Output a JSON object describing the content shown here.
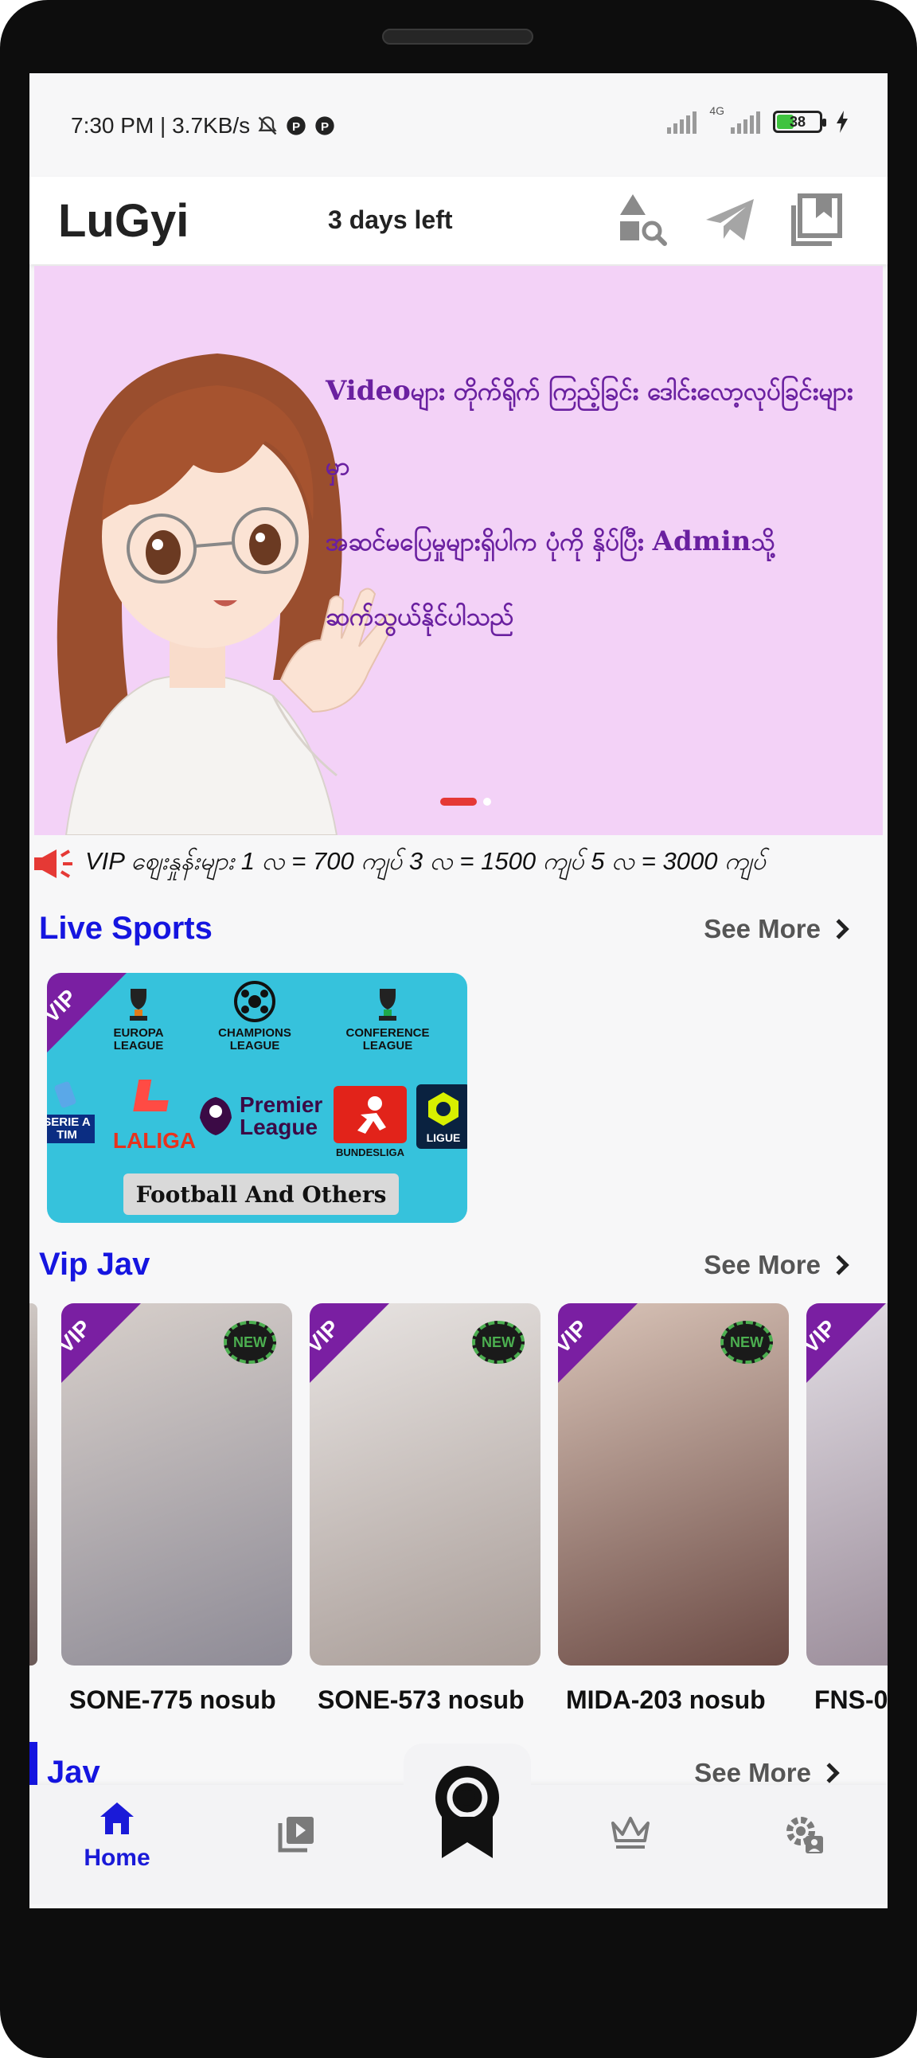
{
  "status_bar": {
    "time_speed": "7:30 PM | 3.7KB/s",
    "network_type": "4G",
    "battery_level": "38"
  },
  "header": {
    "app_name": "LuGyi",
    "days_left": "3 days left",
    "icons": [
      "category-search-icon",
      "telegram-icon",
      "collection-icon"
    ]
  },
  "banner": {
    "line1_bold": "Video",
    "line1_rest": "များ တိုက်ရိုက် ကြည့်ခြင်း ဒေါင်းလော့လုပ်ခြင်းများမှာ",
    "line2_pre": "အဆင်မပြေမှုများရှိပါက ပုံကို နှိပ်ပြီး ",
    "line2_bold": "Admin",
    "line2_post": "သို့",
    "line3": "ဆက်သွယ်နိုင်ပါသည်",
    "slide_count": 2,
    "active_slide": 0
  },
  "announcement": {
    "text": "VIP ဈေးနှုန်းများ 1 လ = 700 ကျပ် 3 လ = 1500 ကျပ် 5 လ = 3000 ကျပ်"
  },
  "live_sports": {
    "title": "Live Sports",
    "see_more": "See More",
    "card": {
      "badge": "VIP",
      "leagues": [
        "EUROPA LEAGUE",
        "CHAMPIONS LEAGUE",
        "CONFERENCE LEAGUE",
        "SERIE A TIM",
        "LALIGA",
        "Premier League",
        "BUNDESLIGA",
        "LIGUE"
      ],
      "footer": "Football And Others"
    }
  },
  "vip_jav": {
    "title": "Vip Jav",
    "see_more": "See More",
    "items": [
      {
        "label": "SONE-775 nosub",
        "badge": "VIP",
        "new_badge": "NEW",
        "colors": [
          "#d8d0cb",
          "#8e8b96"
        ]
      },
      {
        "label": "SONE-573 nosub",
        "badge": "VIP",
        "new_badge": "NEW",
        "colors": [
          "#e8e4e2",
          "#a89c97"
        ]
      },
      {
        "label": "MIDA-203 nosub",
        "badge": "VIP",
        "new_badge": "NEW",
        "colors": [
          "#d9c4b8",
          "#6b4a44"
        ]
      },
      {
        "label": "FNS-0",
        "badge": "VIP",
        "new_badge": "",
        "colors": [
          "#e2dde4",
          "#9d8f9c"
        ]
      }
    ]
  },
  "jav": {
    "title": "Jav",
    "see_more": "See More"
  },
  "bottom_nav": {
    "home_label": "Home",
    "active_color": "#1a1ad8"
  }
}
